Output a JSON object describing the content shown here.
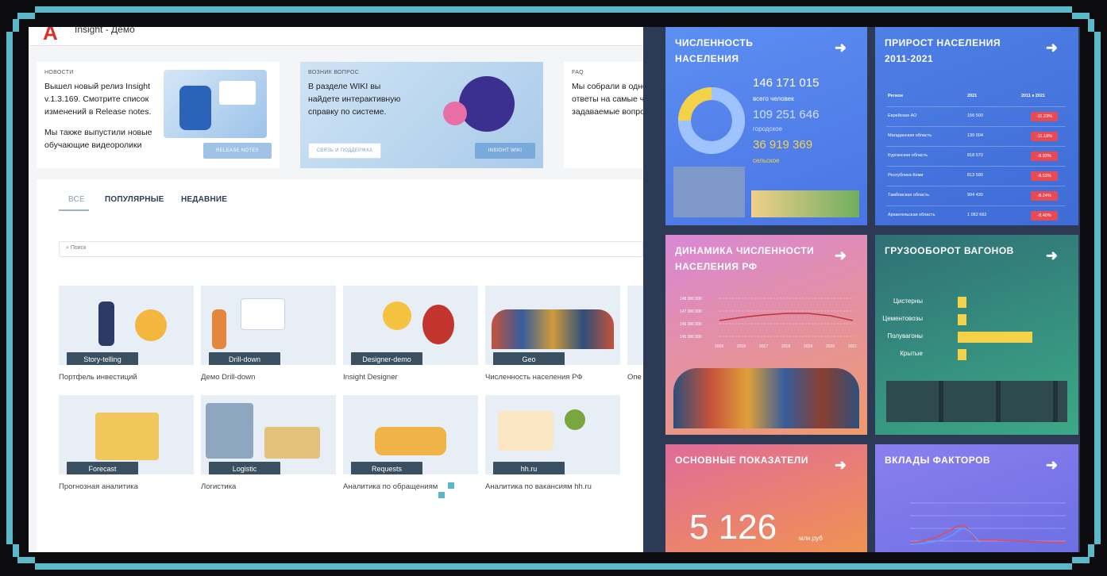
{
  "app": {
    "brand": "Insight - Демо",
    "news": {
      "kicker": "НОВОСТИ",
      "text1": "Вышел новый релиз Insight v.1.3.169. Смотрите список изменений в Release notes.",
      "text2": "Мы также выпустили новые обучающие видеоролики",
      "button": "RELEASE NOTES"
    },
    "question": {
      "kicker": "ВОЗНИК ВОПРОС",
      "text": "В разделе WIKI вы найдете интерактивную справку по системе.",
      "button_left": "СВЯЗЬ И ПОДДЕРЖКА",
      "button_right": "INSIGHT WIKI"
    },
    "faq": {
      "kicker": "FAQ",
      "text": "Мы собрали в одно ответы на самые ч задаваемые вопро"
    },
    "tabs": [
      "ВСЕ",
      "ПОПУЛЯРНЫЕ",
      "НЕДАВНИЕ"
    ],
    "search_placeholder": "Поиск",
    "tiles": [
      {
        "label": "Story-telling",
        "caption": "Портфель инвестиций"
      },
      {
        "label": "Drill-down",
        "caption": "Демо Drill-down"
      },
      {
        "label": "Designer-demo",
        "caption": "Insight Designer"
      },
      {
        "label": "Geo",
        "caption": "Численность населения РФ"
      },
      {
        "label": "",
        "caption": "Опе"
      },
      {
        "label": "Forecast",
        "caption": "Прогнозная аналитика"
      },
      {
        "label": "Logistic",
        "caption": "Логистика"
      },
      {
        "label": "Requests",
        "caption": "Аналитика по обращениям"
      },
      {
        "label": "hh.ru",
        "caption": "Аналитика по вакансиям hh.ru"
      }
    ]
  },
  "dashboard": {
    "population": {
      "title": "ЧИСЛЕННОСТЬ НАСЕЛЕНИЯ",
      "total": "146 171 015",
      "total_label": "всего человек",
      "urban": "109 251 646",
      "urban_label": "городское",
      "rural": "36 919 369",
      "rural_label": "сельское",
      "donut_urban_share": 0.75
    },
    "growth": {
      "title": "ПРИРОСТ НАСЕЛЕНИЯ 2011-2021",
      "headers": [
        "Регион",
        "2021",
        "2011 к 2021"
      ],
      "rows": [
        {
          "region": "Еврейская АО",
          "value": "156 500",
          "change": "-11.23%"
        },
        {
          "region": "Магаданская область",
          "value": "139 004",
          "change": "-11.18%"
        },
        {
          "region": "Курганская область",
          "value": "818 570",
          "change": "-9.93%"
        },
        {
          "region": "Республика Коми",
          "value": "813 590",
          "change": "-9.53%"
        },
        {
          "region": "Тамбовская область",
          "value": "994 430",
          "change": "-8.24%"
        },
        {
          "region": "Архангельская область",
          "value": "1 082 662",
          "change": "-8.46%"
        }
      ]
    },
    "dynamics": {
      "title": "ДИНАМИКА ЧИСЛЕННОСТИ НАСЕЛЕНИЯ РФ",
      "yticks": [
        "148 000 000",
        "147 000 000",
        "146 000 000",
        "145 000 000"
      ],
      "xticks": [
        "2015",
        "2016",
        "2017",
        "2018",
        "2019",
        "2020",
        "2021"
      ]
    },
    "freight": {
      "title": "ГРУЗООБОРОТ ВАГОНОВ",
      "bars": [
        {
          "label": "Цистерны",
          "value": 0.12
        },
        {
          "label": "Цементовозы",
          "value": 0.12
        },
        {
          "label": "Полувагоны",
          "value": 1.0
        },
        {
          "label": "Крытые",
          "value": 0.12
        }
      ]
    },
    "main": {
      "title": "ОСНОВНЫЕ ПОКАЗАТЕЛИ",
      "value": "5 126",
      "unit": "млн.руб"
    },
    "factors": {
      "title": "ВКЛАДЫ ФАКТОРОВ"
    }
  },
  "colors": {
    "frame": "#5bb8c8",
    "accent_red": "#d6342b",
    "tile_label": "#3a5060",
    "badge_red": "#e84a55",
    "bar_yellow": "#f3d24a"
  }
}
